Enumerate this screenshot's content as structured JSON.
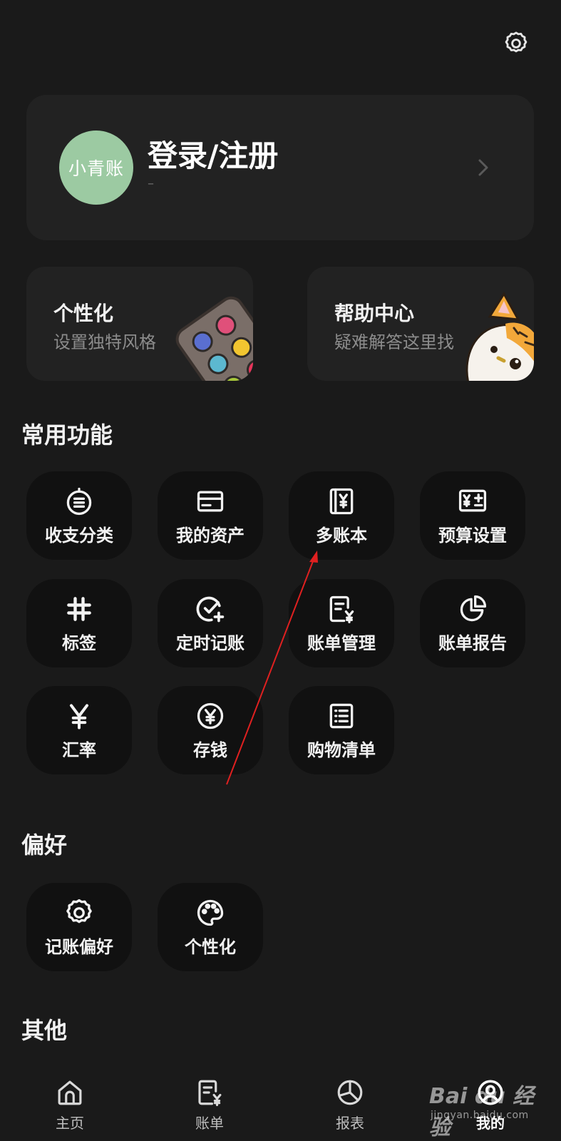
{
  "profile": {
    "avatar_text": "小青账",
    "login_label": "登录/注册",
    "sub_text": "–"
  },
  "features": [
    {
      "title": "个性化",
      "subtitle": "设置独特风格"
    },
    {
      "title": "帮助中心",
      "subtitle": "疑难解答这里找"
    }
  ],
  "sections": {
    "common": "常用功能",
    "preferences": "偏好",
    "other": "其他"
  },
  "common_functions": [
    {
      "label": "收支分类",
      "icon": "category-list-icon"
    },
    {
      "label": "我的资产",
      "icon": "card-icon"
    },
    {
      "label": "多账本",
      "icon": "ledger-book-icon"
    },
    {
      "label": "预算设置",
      "icon": "budget-calculator-icon"
    },
    {
      "label": "标签",
      "icon": "hashtag-icon"
    },
    {
      "label": "定时记账",
      "icon": "scheduled-check-icon"
    },
    {
      "label": "账单管理",
      "icon": "bill-manage-icon"
    },
    {
      "label": "账单报告",
      "icon": "pie-chart-icon"
    },
    {
      "label": "汇率",
      "icon": "yen-icon"
    },
    {
      "label": "存钱",
      "icon": "yen-coin-icon"
    },
    {
      "label": "购物清单",
      "icon": "shopping-list-icon"
    }
  ],
  "preferences": [
    {
      "label": "记账偏好",
      "icon": "gear-icon"
    },
    {
      "label": "个性化",
      "icon": "palette-icon"
    }
  ],
  "bottom_nav": [
    {
      "label": "主页",
      "icon": "home-icon"
    },
    {
      "label": "账单",
      "icon": "bill-icon"
    },
    {
      "label": "报表",
      "icon": "report-icon"
    },
    {
      "label": "我的",
      "icon": "profile-icon",
      "active": true
    }
  ],
  "watermark": {
    "brand": "Bai du 经验",
    "url": "jingyan.baidu.com"
  },
  "colors": {
    "background": "#1a1a1a",
    "card": "#222222",
    "tile": "#111111",
    "avatar": "#9ccaa2",
    "annotation_arrow": "#e02020"
  }
}
